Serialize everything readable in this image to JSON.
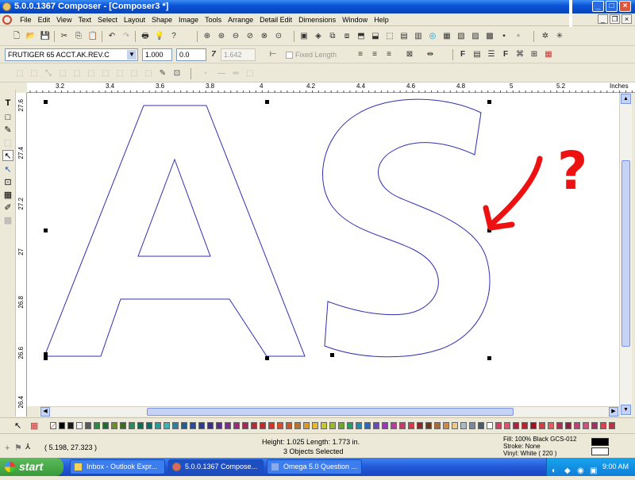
{
  "window": {
    "title": "5.0.0.1367 Composer - [Composer3 *]"
  },
  "menu": [
    "File",
    "Edit",
    "View",
    "Text",
    "Select",
    "Layout",
    "Shape",
    "Image",
    "Tools",
    "Arrange",
    "Detail Edit",
    "Dimensions",
    "Window",
    "Help"
  ],
  "textbar": {
    "font": "FRUTIGER 65 ACCT.AK.REV.C",
    "size": "1.000",
    "offset": "0.0",
    "slant": "1.642",
    "fixed_length": "Fixed Length"
  },
  "ruler": {
    "unit": "Inches",
    "top_ticks": [
      "3.2",
      "3.4",
      "3.6",
      "3.8",
      "4",
      "4.2",
      "4.4",
      "4.6",
      "4.8",
      "5",
      "5.2"
    ],
    "left_ticks": [
      "27.6",
      "27.4",
      "27.2",
      "27",
      "26.8",
      "26.6",
      "26.4"
    ]
  },
  "annotation": {
    "question": "?"
  },
  "status": {
    "coords": "( 5.198, 27.323 )",
    "dims": "Height: 1.025  Length: 1.773  in.",
    "selection": "3 Objects Selected",
    "fill": "Fill: 100% Black GCS-012",
    "stroke": "Stroke: None",
    "vinyl": "Vinyl: White ( 220 )"
  },
  "taskbar": {
    "start": "start",
    "tasks": [
      "Inbox - Outlook Expr...",
      "5.0.0.1367 Compose...",
      "Omega 5.0 Question ..."
    ],
    "clock": "9:00 AM"
  },
  "palette": [
    "#000000",
    "#1a1a1a",
    "#f0f0f0",
    "#5a5a5a",
    "#2b8a3e",
    "#1f6b35",
    "#6e8e2a",
    "#3a6d1e",
    "#2e8b57",
    "#0b6e4f",
    "#126b6b",
    "#2a9a9a",
    "#36b5b5",
    "#2f7f9f",
    "#1f5f8f",
    "#274d9a",
    "#2a3d8f",
    "#3b2f86",
    "#5a2d8a",
    "#7a2d8a",
    "#9a2d7a",
    "#a02a5c",
    "#b52a3a",
    "#c02a2a",
    "#d0342c",
    "#e04a2a",
    "#c85a2a",
    "#b8742a",
    "#d89a2a",
    "#e8b82a",
    "#c8c82a",
    "#9ab82a",
    "#6aa82a",
    "#2a9a6a",
    "#2a8aa8",
    "#2a6ab8",
    "#6a4ab8",
    "#9a3ab8",
    "#b83a9a",
    "#c83a6a",
    "#d83a4a",
    "#8a2a2a",
    "#6a3a1a",
    "#aa6a3a",
    "#cc8a4a",
    "#eaca8a",
    "#aab8c8",
    "#7a8a9a",
    "#4a5a6a",
    "#ffffff",
    "#d04060",
    "#e05070",
    "#b02040",
    "#c02030",
    "#a01020",
    "#d04040",
    "#e06060",
    "#b03050",
    "#902040",
    "#c04070",
    "#d05080",
    "#a03060",
    "#e04050",
    "#c03040"
  ],
  "colors": {
    "outline": "#3030b0",
    "annotation": "#ee1111",
    "selection": "#000000"
  }
}
